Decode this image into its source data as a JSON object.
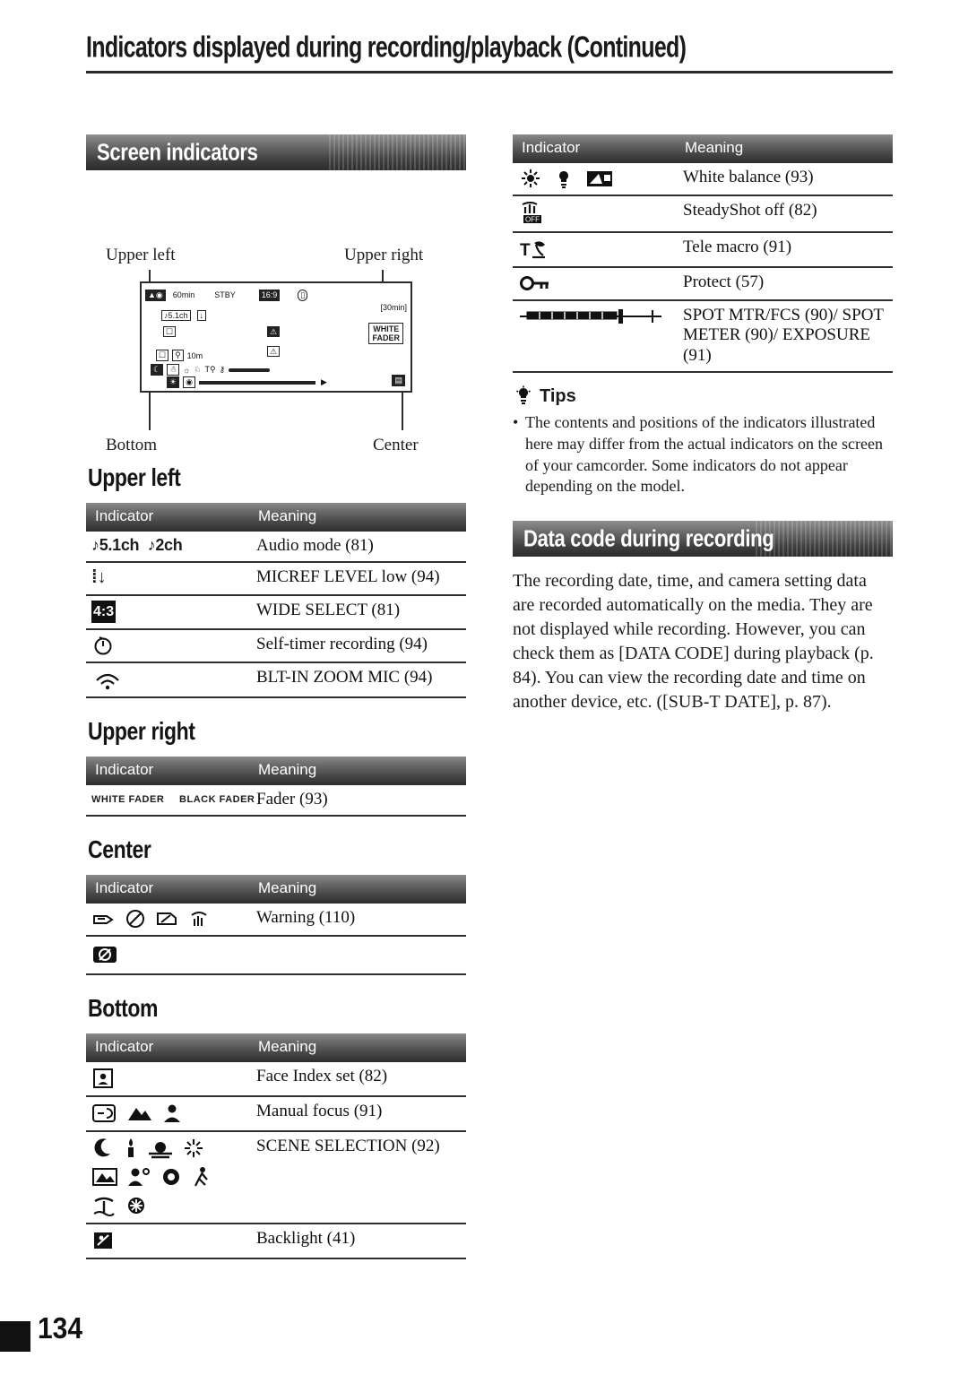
{
  "header": {
    "title": "Indicators displayed during recording/playback (Continued)"
  },
  "folio": "134",
  "left_column": {
    "section_band": "Screen indicators",
    "illustration": {
      "label_upper_left": "Upper left",
      "label_upper_right": "Upper right",
      "label_bottom": "Bottom",
      "label_center": "Center",
      "screen_texts": {
        "battery": "60min",
        "standby": "STBY",
        "remaining": "[30min]",
        "audio": "5.1ch",
        "tele": "10m",
        "white_fader": "WHITE FADER"
      }
    },
    "groups": [
      {
        "heading": "Upper left",
        "columns": [
          "Indicator",
          "Meaning"
        ],
        "rows": [
          {
            "icons": "audio-mode-5.1ch-2ch",
            "meaning": "Audio mode (81)"
          },
          {
            "icons": "micref-level-low",
            "meaning": "MICREF LEVEL low (94)"
          },
          {
            "icons": "wide-select-4-3",
            "meaning": "WIDE SELECT (81)"
          },
          {
            "icons": "self-timer",
            "meaning": "Self-timer recording (94)"
          },
          {
            "icons": "built-in-zoom-mic",
            "meaning": "BLT-IN ZOOM MIC (94)"
          }
        ]
      },
      {
        "heading": "Upper right",
        "columns": [
          "Indicator",
          "Meaning"
        ],
        "rows": [
          {
            "icons": "white-fader-black-fader",
            "meaning": "Fader (93)",
            "icon_text": [
              "WHITE FADER",
              "BLACK FADER"
            ]
          }
        ]
      },
      {
        "heading": "Center",
        "columns": [
          "Indicator",
          "Meaning"
        ],
        "rows": [
          {
            "icons": "warning-icons",
            "meaning": "Warning (110)"
          },
          {
            "icons": "no-photo-icon",
            "meaning": ""
          }
        ]
      },
      {
        "heading": "Bottom",
        "columns": [
          "Indicator",
          "Meaning"
        ],
        "rows": [
          {
            "icons": "face-index-icon",
            "meaning": "Face Index set (82)"
          },
          {
            "icons": "manual-focus-icons",
            "meaning": "Manual focus (91)"
          },
          {
            "icons": "scene-selection-icons",
            "meaning": "SCENE SELECTION (92)"
          },
          {
            "icons": "backlight-icon",
            "meaning": "Backlight (41)"
          }
        ]
      }
    ]
  },
  "right_column": {
    "table": {
      "columns": [
        "Indicator",
        "Meaning"
      ],
      "rows": [
        {
          "icons": "white-balance-icons",
          "meaning": "White balance (93)"
        },
        {
          "icons": "steadyshot-off-icon",
          "meaning": "SteadyShot off (82)"
        },
        {
          "icons": "tele-macro-icon",
          "meaning": "Tele macro (91)"
        },
        {
          "icons": "protect-icon",
          "meaning": "Protect (57)"
        },
        {
          "icons": "spot-meter-slider",
          "meaning": "SPOT MTR/FCS (90)/ SPOT METER (90)/ EXPOSURE (91)"
        }
      ]
    },
    "tips": {
      "label": "Tips",
      "bullet": "•",
      "text": "The contents and positions of the indicators illustrated here may differ from the actual indicators on the screen of your camcorder. Some indicators do not appear depending on the model."
    },
    "section_band": "Data code during recording",
    "paragraph": "The recording date, time, and camera setting data are recorded automatically on the media. They are not displayed while recording. However, you can check them as [DATA CODE] during playback (p. 84). You can view the recording date and time on another device, etc. ([SUB-T DATE], p. 87)."
  }
}
